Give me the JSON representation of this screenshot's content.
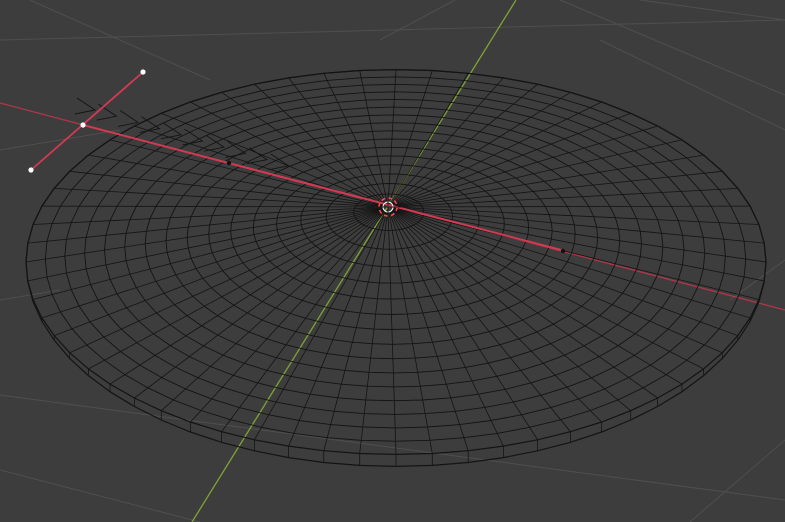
{
  "viewport": {
    "background_color": "#3d3d3d",
    "grid_color": "#4f4f4f",
    "x_axis_color": "#b0364a",
    "y_axis_color": "#7ea235",
    "wire_color": "#141414",
    "selected_edge_color": "#d23a52",
    "vertex_color": "#ffffff",
    "cursor_color": "#ff4a4a"
  },
  "mesh": {
    "name_icon": "torus-wireframe-icon",
    "rings": 16,
    "segments": 64,
    "tilt": 0.35
  },
  "selection": {
    "handle_icon": "bezier-handle-icon",
    "vertices_visible": 3
  },
  "cursor": {
    "icon": "3d-cursor-icon"
  }
}
